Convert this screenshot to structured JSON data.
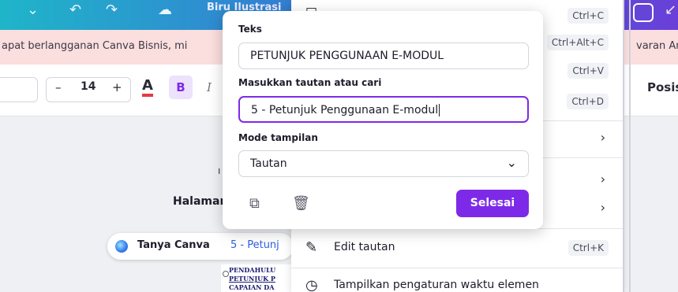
{
  "topbar": {
    "title": "Biru Ilustrasi"
  },
  "banner": {
    "text_left": "apat berlangganan Canva Bisnis, mi",
    "text_right": "varan An"
  },
  "toolbar": {
    "font_size": "14",
    "minus_label": "–",
    "plus_label": "+",
    "text_color_label": "A",
    "bold_label": "B",
    "italic_label": "I",
    "position_label": "Posis"
  },
  "context_menu": {
    "shortcuts": {
      "copy": "Ctrl+C",
      "copy_style": "Ctrl+Alt+C",
      "paste": "Ctrl+V",
      "duplicate": "Ctrl+D",
      "edit_link": "Ctrl+K"
    },
    "edit_link_label": "Edit tautan",
    "timing_label": "Tampilkan pengaturan waktu elemen"
  },
  "link_popup": {
    "text_label": "Teks",
    "text_value": "PETUNJUK PENGGUNAAN E-MODUL",
    "link_label": "Masukkan tautan atau cari",
    "link_value": "5 - Petunjuk Penggunaan E-modul",
    "mode_label": "Mode tampilan",
    "mode_value": "Tautan",
    "done_label": "Selesai"
  },
  "canvas": {
    "page_label": "Halamar",
    "ask_canva_label": "Tanya Canva",
    "ask_canva_link": "5 - Petunj",
    "page_lines": [
      "PENDAHULU",
      "PETUNJUK P",
      "CAPAIAN DA"
    ]
  },
  "colors": {
    "accent": "#7d2ae8",
    "banner_bg": "#fbdede",
    "link": "#2f5fe0"
  }
}
